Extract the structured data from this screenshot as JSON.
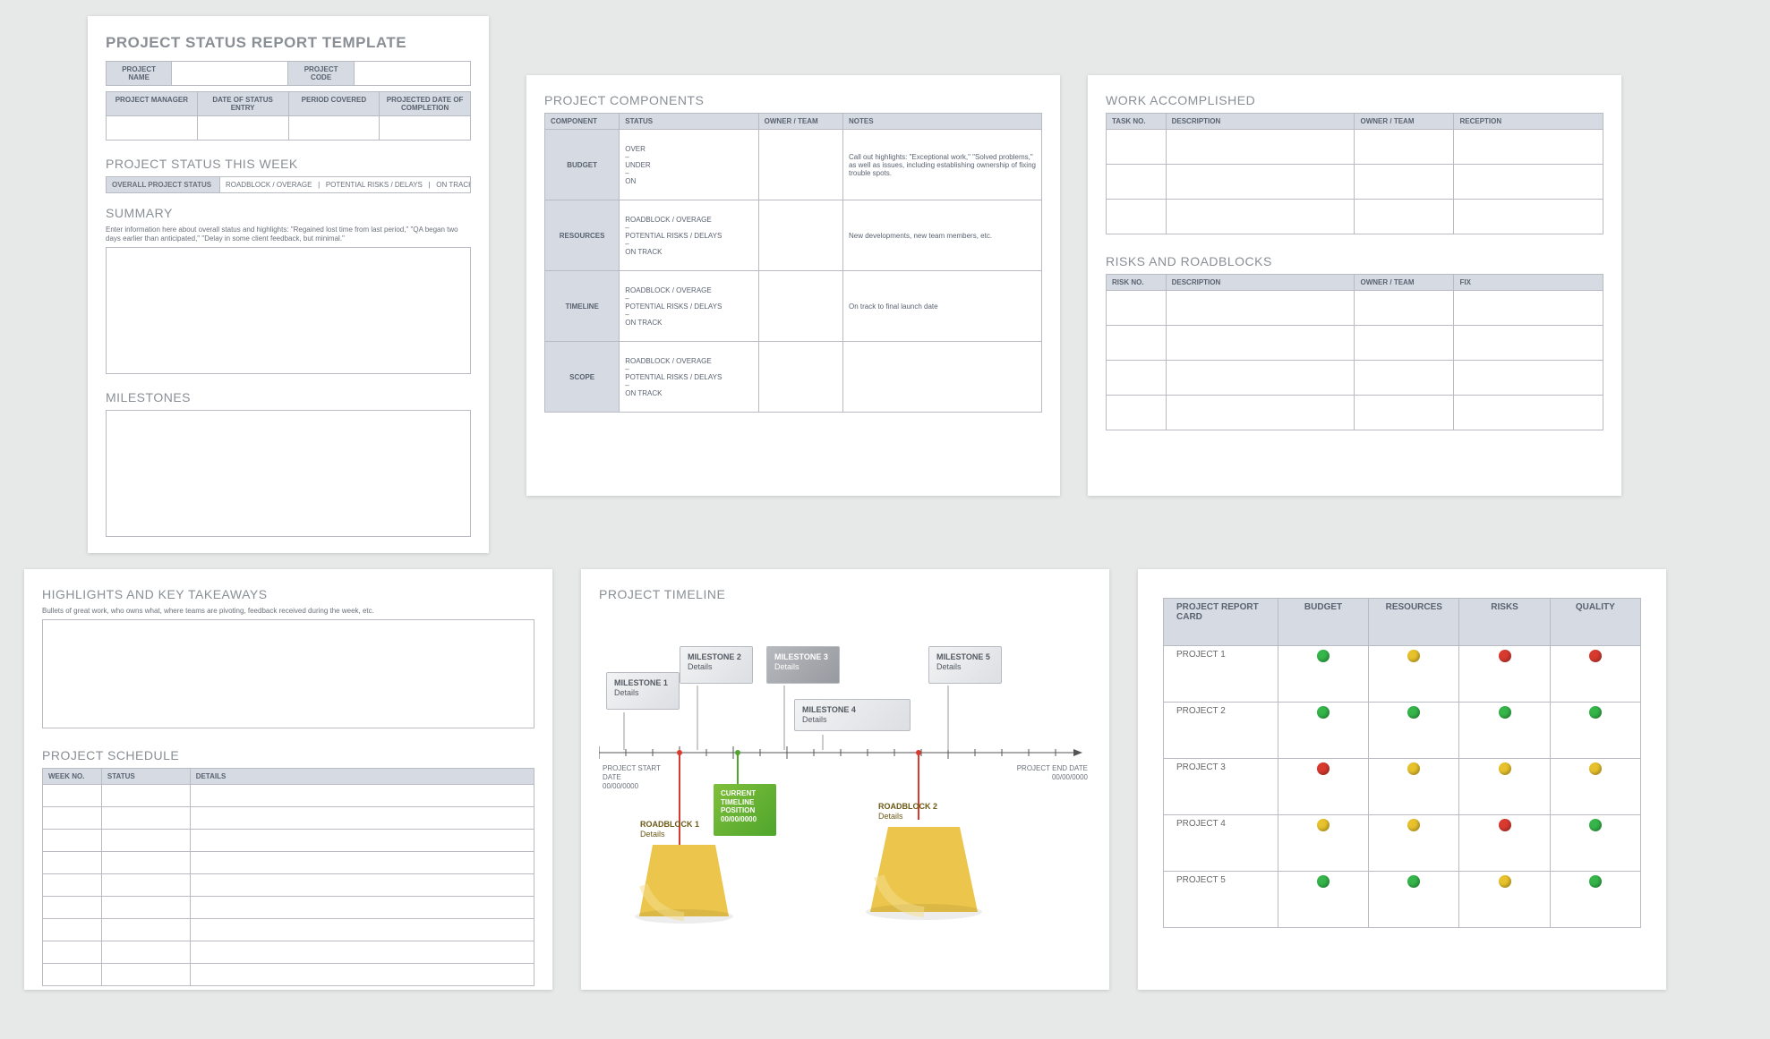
{
  "card1": {
    "title": "PROJECT STATUS REPORT TEMPLATE",
    "row1": {
      "project_name": "PROJECT NAME",
      "project_code": "PROJECT CODE"
    },
    "row2": {
      "pm": "PROJECT MANAGER",
      "date_entry": "DATE OF STATUS ENTRY",
      "period": "PERIOD COVERED",
      "proj_date": "PROJECTED DATE OF COMPLETION"
    },
    "status_week_title": "PROJECT STATUS THIS WEEK",
    "status_row": {
      "label": "OVERALL PROJECT STATUS",
      "v1": "ROADBLOCK / OVERAGE",
      "sep": "|",
      "v2": "POTENTIAL RISKS / DELAYS",
      "v3": "ON TRACK"
    },
    "summary_title": "SUMMARY",
    "summary_note": "Enter information here about overall status and highlights: \"Regained lost time from last period,\" \"QA began two days earlier than anticipated,\" \"Delay in some client feedback, but minimal.\"",
    "milestones_title": "MILESTONES"
  },
  "card2": {
    "title": "PROJECT COMPONENTS",
    "headers": {
      "c1": "COMPONENT",
      "c2": "STATUS",
      "c3": "OWNER / TEAM",
      "c4": "NOTES"
    },
    "rows": [
      {
        "name": "BUDGET",
        "status": "OVER\n–\nUNDER\n–\nON",
        "notes": "Call out highlights:  \"Exceptional work,\"  \"Solved problems,\" as well as issues, including establishing ownership of fixing trouble spots."
      },
      {
        "name": "RESOURCES",
        "status": "ROADBLOCK / OVERAGE\n–\nPOTENTIAL RISKS / DELAYS\n–\nON TRACK",
        "notes": "New developments, new team members, etc."
      },
      {
        "name": "TIMELINE",
        "status": "ROADBLOCK / OVERAGE\n–\nPOTENTIAL RISKS / DELAYS\n–\nON TRACK",
        "notes": "On track to final launch date"
      },
      {
        "name": "SCOPE",
        "status": "ROADBLOCK / OVERAGE\n–\nPOTENTIAL RISKS / DELAYS\n–\nON TRACK",
        "notes": ""
      }
    ]
  },
  "card3": {
    "work_title": "WORK ACCOMPLISHED",
    "work_headers": {
      "c1": "TASK NO.",
      "c2": "DESCRIPTION",
      "c3": "OWNER / TEAM",
      "c4": "RECEPTION"
    },
    "risk_title": "RISKS AND ROADBLOCKS",
    "risk_headers": {
      "c1": "RISK NO.",
      "c2": "DESCRIPTION",
      "c3": "OWNER / TEAM",
      "c4": "FIX"
    }
  },
  "card4": {
    "title": "HIGHLIGHTS AND KEY TAKEAWAYS",
    "note": "Bullets of great work, who owns what, where teams are pivoting, feedback received during the week, etc.",
    "sched_title": "PROJECT SCHEDULE",
    "sched_headers": {
      "c1": "WEEK NO.",
      "c2": "STATUS",
      "c3": "DETAILS"
    }
  },
  "card5": {
    "title": "PROJECT TIMELINE",
    "start": {
      "l1": "PROJECT START DATE",
      "l2": "00/00/0000"
    },
    "end": {
      "l1": "PROJECT END DATE",
      "l2": "00/00/0000"
    },
    "milestones": [
      {
        "t": "MILESTONE 1",
        "d": "Details"
      },
      {
        "t": "MILESTONE 2",
        "d": "Details"
      },
      {
        "t": "MILESTONE 3",
        "d": "Details"
      },
      {
        "t": "MILESTONE 4",
        "d": "Details"
      },
      {
        "t": "MILESTONE 5",
        "d": "Details"
      }
    ],
    "current": {
      "l1": "CURRENT",
      "l2": "TIMELINE",
      "l3": "POSITION",
      "l4": "00/00/0000"
    },
    "roadblocks": [
      {
        "t": "ROADBLOCK 1",
        "d": "Details"
      },
      {
        "t": "ROADBLOCK 2",
        "d": "Details"
      }
    ]
  },
  "card6": {
    "header": {
      "c1": "PROJECT REPORT CARD",
      "c2": "BUDGET",
      "c3": "RESOURCES",
      "c4": "RISKS",
      "c5": "QUALITY"
    },
    "rows": [
      {
        "name": "PROJECT 1",
        "vals": [
          "g",
          "y",
          "r",
          "r"
        ]
      },
      {
        "name": "PROJECT 2",
        "vals": [
          "g",
          "g",
          "g",
          "g"
        ]
      },
      {
        "name": "PROJECT 3",
        "vals": [
          "r",
          "y",
          "y",
          "y"
        ]
      },
      {
        "name": "PROJECT 4",
        "vals": [
          "y",
          "y",
          "r",
          "g"
        ]
      },
      {
        "name": "PROJECT 5",
        "vals": [
          "g",
          "g",
          "y",
          "g"
        ]
      }
    ]
  }
}
